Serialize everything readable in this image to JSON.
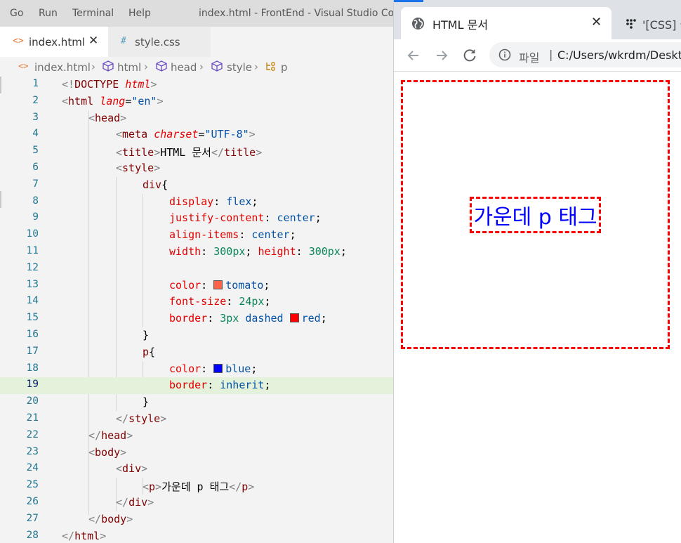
{
  "vscode": {
    "menu": [
      "Go",
      "Run",
      "Terminal",
      "Help"
    ],
    "window_title": "index.html - FrontEnd - Visual Studio Code",
    "tabs": [
      {
        "icon": "<>",
        "label": "index.html",
        "close": "✕"
      },
      {
        "icon": "#",
        "label": "style.css"
      }
    ],
    "breadcrumbs": [
      "index.html",
      "html",
      "head",
      "style",
      "p"
    ],
    "line_numbers": [
      "1",
      "2",
      "3",
      "4",
      "5",
      "6",
      "7",
      "8",
      "9",
      "10",
      "11",
      "12",
      "13",
      "14",
      "15",
      "16",
      "17",
      "18",
      "19",
      "20",
      "21",
      "22",
      "23",
      "24",
      "25",
      "26",
      "27",
      "28"
    ],
    "code": {
      "l1_a": "<!",
      "l1_b": "DOCTYPE",
      "l1_c": " html",
      "l1_d": ">",
      "l2_tag": "html",
      "l2_attr": "lang",
      "l2_val": "\"en\"",
      "l3_tag": "head",
      "l4_tag": "meta",
      "l4_attr": "charset",
      "l4_val": "\"UTF-8\"",
      "l5_tag": "title",
      "l5_text": "HTML 문서",
      "l6_tag": "style",
      "l7_sel": "div",
      "l8_prop": "display",
      "l8_val": "flex",
      "l9_prop": "justify-content",
      "l9_val": "center",
      "l10_prop": "align-items",
      "l10_val": "center",
      "l11_prop1": "width",
      "l11_num1": "300",
      "l11_unit1": "px",
      "l11_prop2": "height",
      "l11_num2": "300",
      "l11_unit2": "px",
      "l13_prop": "color",
      "l13_val": "tomato",
      "l14_prop": "font-size",
      "l14_num": "24",
      "l14_unit": "px",
      "l15_prop": "border",
      "l15_num": "3",
      "l15_unit": "px",
      "l15_kw": "dashed",
      "l15_val": "red",
      "l16": "}",
      "l17_sel": "p",
      "l18_prop": "color",
      "l18_val": "blue",
      "l19_prop": "border",
      "l19_val": "inherit",
      "l20": "}",
      "l21_tag": "style",
      "l22_tag": "head",
      "l23_tag": "body",
      "l24_tag": "div",
      "l25_tag": "p",
      "l25_text": "가운데 p 태그",
      "l26_tag": "div",
      "l27_tag": "body",
      "l28_tag": "html"
    },
    "colors": {
      "tomato": "#ff6347",
      "red": "#ff0000",
      "blue": "#0000ff"
    }
  },
  "chrome": {
    "tab_title": "HTML 문서",
    "tab_close": "✕",
    "tab2_title": "'[CSS] 웹",
    "omnibox_label": "파일",
    "omnibox_sep": "|",
    "omnibox_url": "C:/Users/wkrdm/Desktop",
    "page_text": "가운데 p 태그"
  }
}
